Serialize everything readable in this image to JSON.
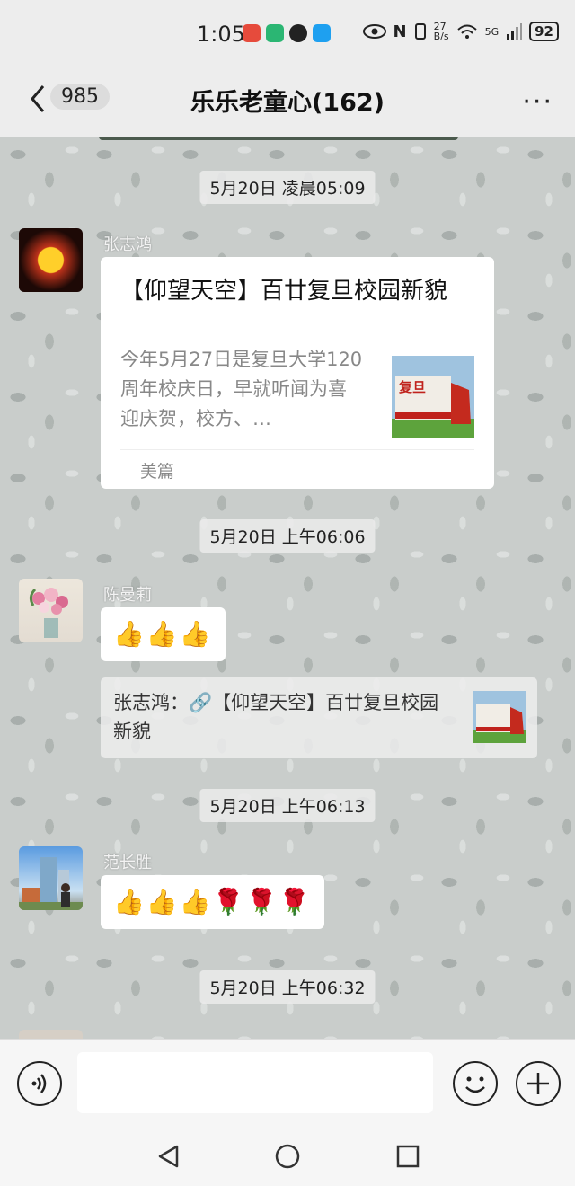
{
  "status": {
    "time": "1:05",
    "net_speed_top": "27",
    "net_speed_unit": "B/s",
    "signal": "5G",
    "battery": "92"
  },
  "header": {
    "unread_count": "985",
    "title": "乐乐老童心(162)",
    "more": "···"
  },
  "messages": {
    "t1": "5月20日 凌晨05:09",
    "m1": {
      "sender": "张志鸿",
      "card_title": "【仰望天空】百廿复旦校园新貌",
      "card_desc": "今年5月27日是复旦大学120周年校庆日，早就听闻为喜迎庆贺，校方、…",
      "card_source": "美篇"
    },
    "t2": "5月20日 上午06:06",
    "m2": {
      "sender": "陈曼莉",
      "quote": "张志鸿：🔗【仰望天空】百廿复旦校园新貌"
    },
    "t3": "5月20日 上午06:13",
    "m3": {
      "sender": "范长胜"
    },
    "t4": "5月20日 上午06:32"
  },
  "icons": {
    "thumbs_up": "👍",
    "rose": "🌹"
  },
  "colors": {
    "chat_bg": "#c9cdcb",
    "bubble": "#ffffff",
    "header_bg": "#ededed"
  }
}
